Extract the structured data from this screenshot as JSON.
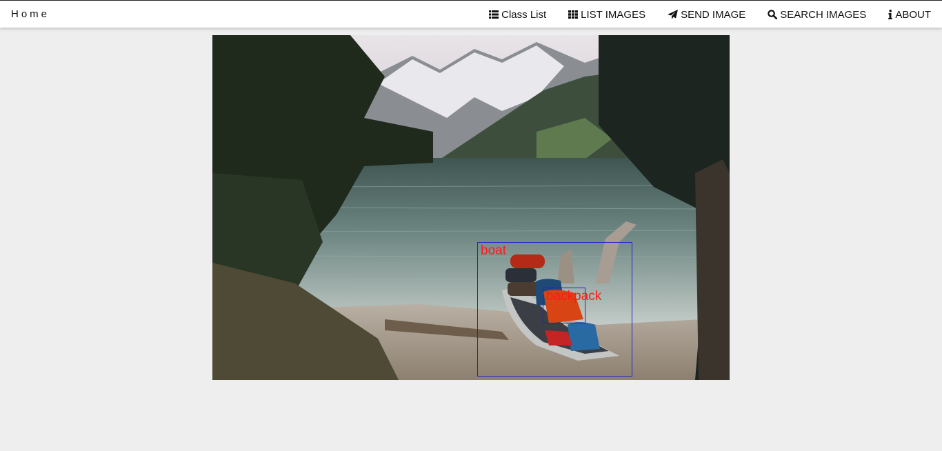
{
  "nav": {
    "brand": "Home",
    "items": [
      {
        "label": "Class List",
        "icon": "list-icon"
      },
      {
        "label": "LIST IMAGES",
        "icon": "grid-icon"
      },
      {
        "label": "SEND IMAGE",
        "icon": "paper-plane-icon"
      },
      {
        "label": "SEARCH IMAGES",
        "icon": "search-icon"
      },
      {
        "label": "ABOUT",
        "icon": "info-icon"
      }
    ]
  },
  "detections": [
    {
      "label": "boat",
      "color": "#2222cc",
      "label_color": "#ff1a1a"
    },
    {
      "label": "backpack",
      "color": "#2222cc",
      "label_color": "#ff1a1a"
    }
  ]
}
